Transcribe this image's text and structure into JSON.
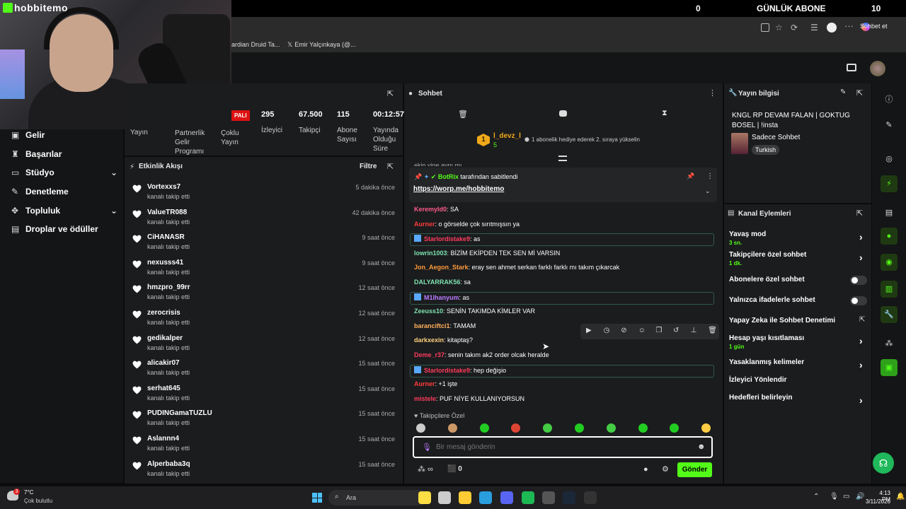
{
  "overlay": {
    "brand": "hobbitemo",
    "count": "0",
    "title": "GÜNLÜK ABONE",
    "right": "10"
  },
  "browser": {
    "bookmarks": [
      "ardian Druid Ta...",
      "Emir Yalçınkaya (@..."
    ],
    "chat_btn": "Sohbet et"
  },
  "nav": {
    "items": [
      {
        "label": "Gelir",
        "icon": "money-icon"
      },
      {
        "label": "Başarılar",
        "icon": "trophy-icon"
      },
      {
        "label": "Stüdyo",
        "icon": "studio-icon",
        "chevron": true
      },
      {
        "label": "Denetleme",
        "icon": "wrench-icon"
      },
      {
        "label": "Topluluk",
        "icon": "community-icon",
        "chevron": true
      },
      {
        "label": "Droplar ve ödüller",
        "icon": "drops-icon"
      }
    ]
  },
  "stats": {
    "tabs": [
      "Yayın",
      "Partnerlik Gelir Programı",
      "Çoklu Yayın"
    ],
    "badge": "PALI",
    "metrics": [
      {
        "value": "295",
        "label": "İzleyici"
      },
      {
        "value": "67.500",
        "label": "Takipçi"
      },
      {
        "value": "115",
        "label": "Abone Sayısı"
      },
      {
        "value": "00:12:57",
        "label": "Yayında Olduğu Süre"
      }
    ]
  },
  "activity": {
    "title": "Etkinlik Akışı",
    "filter": "Filtre",
    "sub": "kanalı takip etti",
    "items": [
      {
        "name": "Vortexxs7",
        "time": "5 dakika önce"
      },
      {
        "name": "ValueTR088",
        "time": "42 dakika önce"
      },
      {
        "name": "CiHANASR",
        "time": "9 saat önce"
      },
      {
        "name": "nexusss41",
        "time": "9 saat önce"
      },
      {
        "name": "hmzpro_99rr",
        "time": "12 saat önce"
      },
      {
        "name": "zerocrisis",
        "time": "12 saat önce"
      },
      {
        "name": "gedikalper",
        "time": "12 saat önce"
      },
      {
        "name": "alicakir07",
        "time": "15 saat önce"
      },
      {
        "name": "serhat645",
        "time": "15 saat önce"
      },
      {
        "name": "PUDINGamaTUZLU",
        "time": "15 saat önce"
      },
      {
        "name": "Aslannn4",
        "time": "15 saat önce"
      },
      {
        "name": "Alperbaba3q",
        "time": "15 saat önce"
      }
    ]
  },
  "chat": {
    "title": "Sohbet",
    "gifter": {
      "rank": "1",
      "name": "l_devz_l",
      "count": "5",
      "text": "1 abonelik hediye ederek 2. sıraya yükselin"
    },
    "cut_msg": "ekip yine aynı mı",
    "pinned": {
      "by": "BotRix",
      "suffix": "tarafından sabitlendi",
      "link": "https://worp.me/hobbitemo"
    },
    "messages": [
      {
        "user": "Keremyld0",
        "color": "#ff5c8a",
        "text": ": SA",
        "hl": false
      },
      {
        "user": "Aurner",
        "color": "#ff3b3b",
        "text": ": o görselde çok sırıtmışsın ya",
        "hl": false
      },
      {
        "user": "Starlordistake9",
        "color": "#ff3b5c",
        "text": ": as",
        "hl": true
      },
      {
        "user": "lowrin1003",
        "color": "#7fe3b0",
        "text": ": BİZİM EKİPDEN TEK SEN Mİ VARSIN",
        "hl": false
      },
      {
        "user": "Jon_Aegon_Stark",
        "color": "#ff9a3c",
        "text": ": eray sen ahmet serkan farklı farklı mı takım çıkarcak",
        "hl": false
      },
      {
        "user": "DALYARRAK56",
        "color": "#7fe3b0",
        "text": ": sa",
        "hl": false
      },
      {
        "user": "M1lhanyum",
        "color": "#b87cff",
        "text": ": as",
        "hl": true
      },
      {
        "user": "Zeeuss10",
        "color": "#7fe3b0",
        "text": ": SENİN TAKIMDA KİMLER VAR",
        "hl": false
      },
      {
        "user": "baranciftci1",
        "color": "#ffb15c",
        "text": ": TAMAM",
        "hl": false
      },
      {
        "user": "darkxexin",
        "color": "#ffd27f",
        "text": ": kitaptaş?",
        "hl": false
      },
      {
        "user": "Deme_r37",
        "color": "#ff3b5c",
        "text": ": senin takım ak2 order olcak heralde",
        "hl": false
      },
      {
        "user": "Starlordistake9",
        "color": "#ff3b5c",
        "text": ": hep değişio",
        "hl": true
      },
      {
        "user": "Aurner",
        "color": "#ff3b3b",
        "text": ": +1 işte",
        "hl": false
      },
      {
        "user": "mistele",
        "color": "#ff3b5c",
        "text": ": PUF NİYE KULLANIYORSUN",
        "hl": false
      }
    ],
    "followers_only": "Takipçilere Özel",
    "placeholder": "Bir mesaj gönderin",
    "count": "0",
    "send": "Gönder"
  },
  "info": {
    "title": "Yayın bilgisi",
    "stream_title": "KNGL RP DEVAM FALAN | GOKTUG BOSEL | !insta",
    "category": "Sadece Sohbet",
    "tag": "Turkish"
  },
  "actions": {
    "title": "Kanal Eylemleri",
    "items": [
      {
        "label": "Yavaş mod",
        "sub": "3 sn.",
        "kind": "chevron"
      },
      {
        "label": "Takipçilere özel sohbet",
        "sub": "1 dk.",
        "kind": "chevron"
      },
      {
        "label": "Abonelere özel sohbet",
        "sub": "",
        "kind": "toggle"
      },
      {
        "label": "Yalnızca ifadelerle sohbet",
        "sub": "",
        "kind": "toggle"
      },
      {
        "label": "Yapay Zeka ile Sohbet Denetimi",
        "sub": "",
        "kind": "external"
      },
      {
        "label": "Hesap yaşı kısıtlaması",
        "sub": "1 gün",
        "kind": "chevron"
      },
      {
        "label": "Yasaklanmış kelimeler",
        "sub": "",
        "kind": "chevron"
      },
      {
        "label": "İzleyici Yönlendir",
        "sub": "",
        "kind": "none"
      },
      {
        "label": "Hedefleri belirleyin",
        "sub": "",
        "kind": "chevron"
      }
    ]
  },
  "taskbar": {
    "temp": "7°C",
    "weather": "Çok bulutlu",
    "search": "Ara",
    "time": "4:13 PM",
    "date": "3/11/2026",
    "notif": "3"
  },
  "colors": {
    "accent": "#53fc18",
    "panel": "#1b1c1e",
    "bg": "#0b0b0c"
  }
}
